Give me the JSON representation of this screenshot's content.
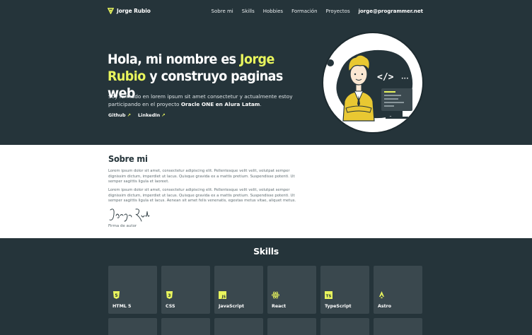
{
  "nav": {
    "logo_text": "Jorge Rubio",
    "links": [
      "Sobre mi",
      "Skills",
      "Hobbies",
      "Formación",
      "Proyectos"
    ],
    "email": "jorge@programmer.net"
  },
  "hero": {
    "title_part1": "Hola, mi nombre es ",
    "title_highlight": "Jorge Rubio",
    "title_part2": " y construyo paginas web",
    "desc_part1": "Soy formado en lorem ipsum sit amet consectetur y actualmente estoy participando en el proyecto ",
    "desc_bold": "Oracle ONE en Alura Latam",
    "desc_part2": ".",
    "link_github": "Github",
    "link_linkedin": "LinkedIn"
  },
  "about": {
    "title": "Sobre mi",
    "p1": "Lorem ipsum dolor sit amet, consectetur adipiscing elit. Pellentesque velit velit, volutpat semper dignissim dictum, imperdiet ut lacus. Quisque gravida ex a mattis pretium. Suspendisse potenti. Ut semper sagittis ligula et laoreet.",
    "p2": "Lorem ipsum dolor sit amet, consectetur adipiscing elit. Pellentesque velit velit, volutpat semper dignissim dictum, imperdiet ut lacus. Quisque gravida ex a mattis pretium. Suspendisse potenti. Ut semper sagittis ligula et lacus. Aenean sit amet felis venenatis, egestas metus vitae, aliquet metus.",
    "signature": "Jorge Rubio",
    "signature_label": "Firma de autor"
  },
  "skills": {
    "title": "Skills",
    "items": [
      {
        "name": "HTML 5",
        "icon": "html5-icon"
      },
      {
        "name": "CSS",
        "icon": "css3-icon"
      },
      {
        "name": "JavaScript",
        "icon": "javascript-icon"
      },
      {
        "name": "React",
        "icon": "react-icon"
      },
      {
        "name": "TypeScript",
        "icon": "typescript-icon"
      },
      {
        "name": "Astro",
        "icon": "astro-icon"
      }
    ]
  },
  "colors": {
    "background": "#25343a",
    "accent": "#e9f55d",
    "card": "#3a484e",
    "section_light": "#ffffff"
  }
}
